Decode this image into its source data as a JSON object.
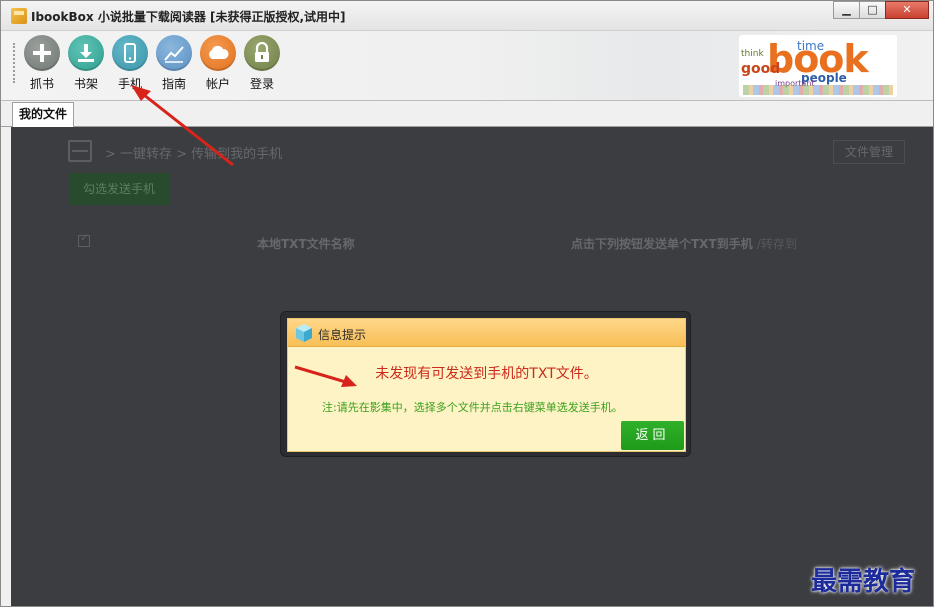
{
  "window": {
    "title": "IbookBox 小说批量下载阅读器 [未获得正版授权,试用中]",
    "min_label": "▁",
    "max_label": "□",
    "close_label": "✕"
  },
  "toolbar": {
    "items": [
      {
        "label": "抓书",
        "icon": "plus-icon"
      },
      {
        "label": "书架",
        "icon": "download-icon"
      },
      {
        "label": "手机",
        "icon": "phone-icon"
      },
      {
        "label": "指南",
        "icon": "chart-icon"
      },
      {
        "label": "帐户",
        "icon": "cloud-icon"
      },
      {
        "label": "登录",
        "icon": "lock-icon"
      }
    ],
    "logo_word": "book",
    "logo_words": [
      "think",
      "time",
      "good",
      "people",
      "important"
    ]
  },
  "tabs": [
    {
      "label": "我的文件"
    }
  ],
  "content": {
    "breadcrumb": "> 一键转存 > 传输到我的手机",
    "file_mgmt": "文件管理",
    "send_button": "勾选发送手机",
    "col_name": "本地TXT文件名称",
    "col_action": "点击下列按钮发送单个TXT到手机",
    "col_action_tail": "/转存到"
  },
  "dialog": {
    "title": "信息提示",
    "message": "未发现有可发送到手机的TXT文件。",
    "note": "注:请先在影集中，选择多个文件并点击右键菜单选发送手机。",
    "back_label": "返回"
  },
  "watermark": "最需教育",
  "colors": {
    "content_bg": "#3b3d41",
    "dialog_bg": "#fdf3c4",
    "dialog_header": "#f7bf55",
    "message_red": "#cc2a1a",
    "note_green": "#3aa01e",
    "back_green": "#1f9a1a",
    "arrow_red": "#d8231b"
  }
}
